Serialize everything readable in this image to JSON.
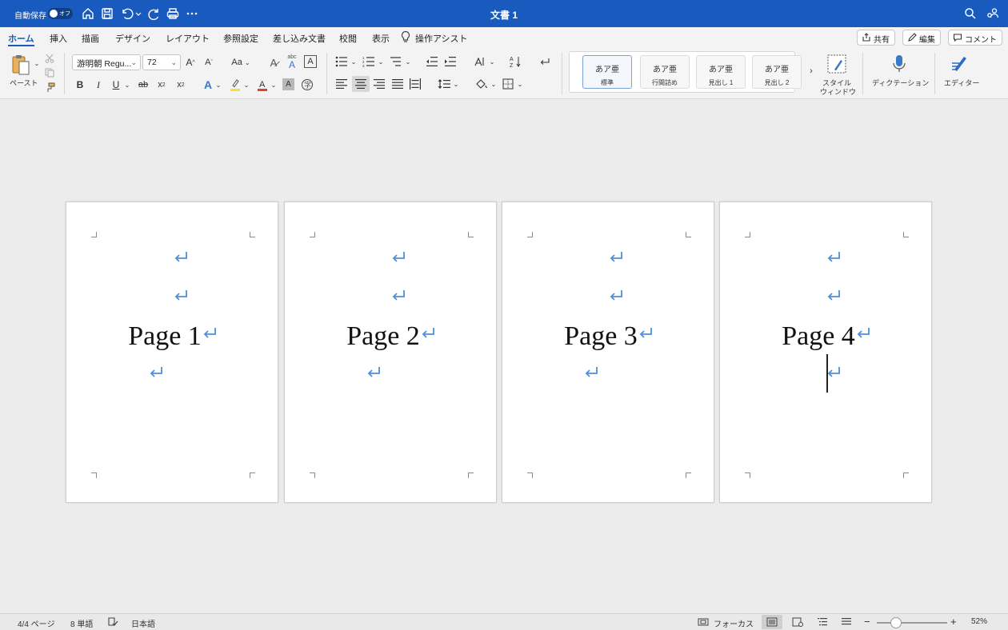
{
  "titlebar": {
    "autosave_label": "自動保存",
    "autosave_state": "オフ",
    "doc_title": "文書 1",
    "bg_color": "#185abd"
  },
  "tabs": [
    "ホーム",
    "挿入",
    "描画",
    "デザイン",
    "レイアウト",
    "参照設定",
    "差し込み文書",
    "校閲",
    "表示"
  ],
  "assist_label": "操作アシスト",
  "header_buttons": {
    "share": "共有",
    "edit": "編集",
    "comment": "コメント"
  },
  "ribbon": {
    "paste_label": "ペースト",
    "font_name": "游明朝 Regu...",
    "font_size": "72",
    "case_label": "Aa",
    "styles": [
      {
        "sample": "あア亜",
        "name": "標準"
      },
      {
        "sample": "あア亜",
        "name": "行間詰め"
      },
      {
        "sample": "あア亜",
        "name": "見出し 1"
      },
      {
        "sample": "あア亜",
        "name": "見出し 2"
      }
    ],
    "style_window_label_1": "スタイル",
    "style_window_label_2": "ウィンドウ",
    "dictation_label": "ディクテーション",
    "editor_label": "エディター"
  },
  "pages": [
    {
      "text": "Page 1"
    },
    {
      "text": "Page 2"
    },
    {
      "text": "Page 3"
    },
    {
      "text": "Page 4"
    }
  ],
  "statusbar": {
    "page_info": "4/4 ページ",
    "word_count": "8 単語",
    "language": "日本語",
    "focus_label": "フォーカス",
    "zoom_minus": "−",
    "zoom_plus": "+",
    "zoom_level": "52%"
  },
  "icons": [
    "home-icon",
    "save-icon",
    "undo-icon",
    "redo-icon",
    "print-icon",
    "more-icon",
    "search-icon",
    "account-icon",
    "lightbulb-icon",
    "paragraph-mark-icon"
  ]
}
